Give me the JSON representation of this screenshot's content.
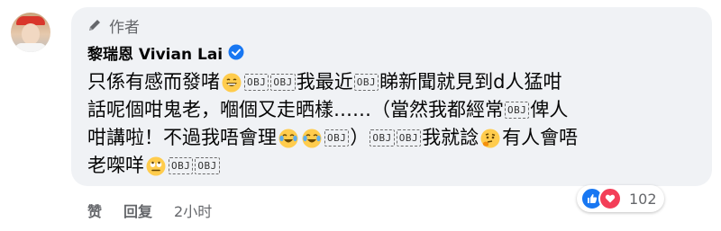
{
  "author_badge": {
    "label": "作者",
    "icon": "pen-icon"
  },
  "commenter": {
    "name": "黎瑞恩 Vivian Lai",
    "verified": true,
    "verified_color": "#1877f2"
  },
  "comment": {
    "line1": {
      "t1": "只係有感而發啫",
      "t2": "我最近",
      "t3": "睇新聞就見到d人猛咁"
    },
    "line2": {
      "t1": "話呢個咁鬼老，嗰個又走晒樣……（當然我都經常",
      "t2": "俾人"
    },
    "line3": {
      "t1": "咁講啦！不過我唔會理",
      "t2": "）",
      "t3": "我就諗",
      "t4": "有人會唔"
    },
    "line4": {
      "t1": "老㗎咩"
    },
    "obj_label": "OBJ"
  },
  "reactions": {
    "count": "102",
    "icons": [
      "like-icon",
      "love-icon"
    ]
  },
  "actions": {
    "like": "赞",
    "reply": "回复",
    "time": "2小时"
  },
  "colors": {
    "bubble": "#f0f2f5",
    "text": "#050505",
    "secondary": "#65676b",
    "like": "#1877f2",
    "love": "#f33e58"
  }
}
